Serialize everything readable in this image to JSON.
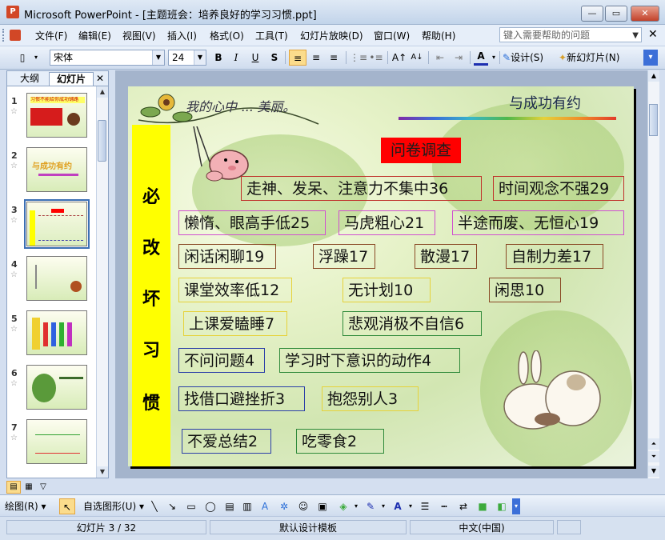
{
  "window": {
    "app_icon": "powerpoint-icon",
    "title": "Microsoft PowerPoint - [主题班会：培养良好的学习习惯.ppt]",
    "minimize": "—",
    "restore": "▭",
    "close": "✕"
  },
  "menu": {
    "items": [
      "文件(F)",
      "编辑(E)",
      "视图(V)",
      "插入(I)",
      "格式(O)",
      "工具(T)",
      "幻灯片放映(D)",
      "窗口(W)",
      "帮助(H)"
    ],
    "help_placeholder": "键入需要帮助的问题"
  },
  "toolbar": {
    "font": "宋体",
    "size": "24",
    "bold": "B",
    "italic": "I",
    "underline": "U",
    "shadow": "S",
    "font_color_glyph": "A",
    "design_label": "设计(S)",
    "new_slide_label": "新幻灯片(N)"
  },
  "outline_tabs": {
    "outline": "大纲",
    "slides": "幻灯片"
  },
  "thumbnails": [
    {
      "num": "1",
      "text": "习惯不能给你成功铺路"
    },
    {
      "num": "2",
      "text": "与成功有约"
    },
    {
      "num": "3",
      "text": "必改坏习惯",
      "selected": true
    },
    {
      "num": "4",
      "text": ""
    },
    {
      "num": "5",
      "text": ""
    },
    {
      "num": "6",
      "text": ""
    },
    {
      "num": "7",
      "text": ""
    }
  ],
  "slide": {
    "title": "与成功有约",
    "script_text": "我的心中 ... 美丽。",
    "vertical_label": [
      "必",
      "改",
      "坏",
      "习",
      "惯"
    ],
    "survey_label": "问卷调查",
    "items": [
      "走神、发呆、注意力不集中36",
      "时间观念不强29",
      "懒惰、眼高手低25",
      "马虎粗心21",
      "半途而废、无恒心19",
      "闲话闲聊19",
      "浮躁17",
      "散漫17",
      "自制力差17",
      "课堂效率低12",
      "无计划10",
      "闲思10",
      "上课爱瞌睡7",
      "悲观消极不自信6",
      "不问问题4",
      "学习时下意识的动作4",
      "找借口避挫折3",
      "抱怨别人3",
      "不爱总结2",
      "吃零食2"
    ]
  },
  "drawing_toolbar": {
    "draw_label": "绘图(R)",
    "autoshape_label": "自选图形(U)"
  },
  "status": {
    "slide_pos": "幻灯片 3 / 32",
    "template": "默认设计模板",
    "language": "中文(中国)"
  }
}
